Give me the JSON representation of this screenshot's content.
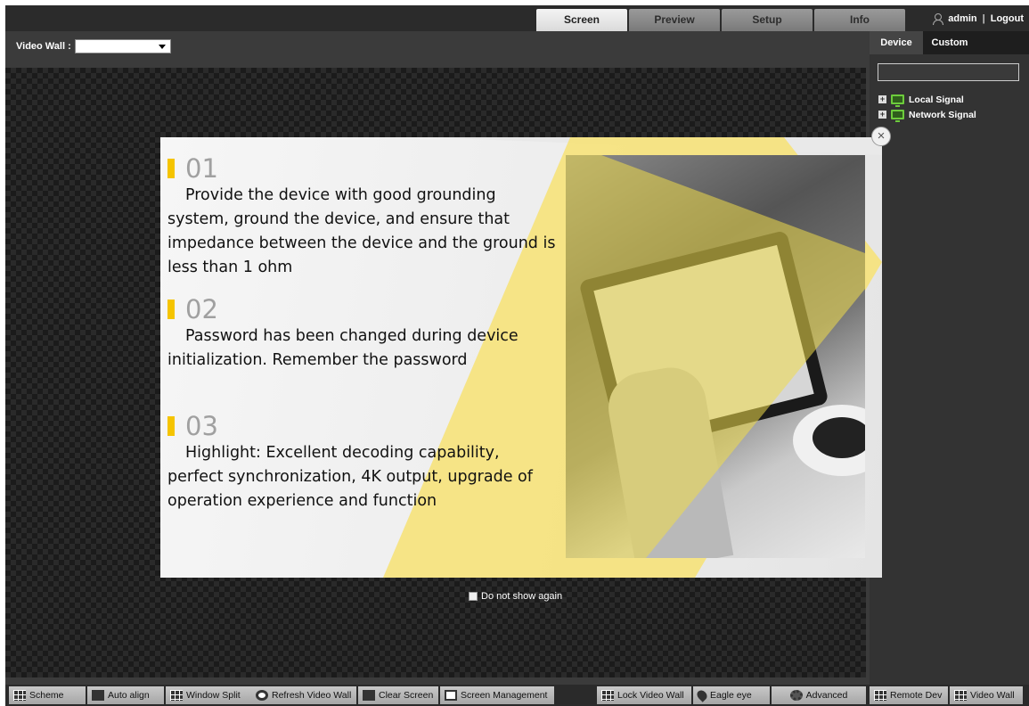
{
  "header": {
    "tabs": [
      {
        "label": "Screen",
        "active": true
      },
      {
        "label": "Preview",
        "active": false
      },
      {
        "label": "Setup",
        "active": false
      },
      {
        "label": "Info",
        "active": false
      }
    ],
    "user": "admin",
    "separator": "|",
    "logout": "Logout"
  },
  "workspace": {
    "video_wall_label": "Video Wall :",
    "video_wall_value": ""
  },
  "right_panel": {
    "tabs": [
      {
        "label": "Device",
        "active": true
      },
      {
        "label": "Custom",
        "active": false
      }
    ],
    "search_value": "",
    "tree": [
      {
        "label": "Local Signal",
        "icon": "local-signal-icon"
      },
      {
        "label": "Network Signal",
        "icon": "network-signal-icon"
      }
    ]
  },
  "popup": {
    "points": [
      {
        "number": "01",
        "text": "Provide the device with good grounding system, ground the device, and ensure that impedance between the device and the ground is less than 1 ohm"
      },
      {
        "number": "02",
        "text": "Password has been changed during device initialization. Remember the password"
      },
      {
        "number": "03",
        "text": "Highlight: Excellent decoding capability, perfect synchronization, 4K output, upgrade of operation experience and function"
      }
    ],
    "close_symbol": "×",
    "dont_show_label": "Do not show again",
    "accent_color": "#f5c400"
  },
  "toolbar": {
    "left": [
      {
        "label": "Scheme",
        "icon": "scheme-icon"
      },
      {
        "label": "Auto align",
        "icon": "auto-align-icon"
      },
      {
        "label": "Window Split",
        "icon": "window-split-icon"
      },
      {
        "label": "Refresh Video Wall",
        "icon": "refresh-icon"
      },
      {
        "label": "Clear Screen",
        "icon": "clear-screen-icon"
      },
      {
        "label": "Screen Management",
        "icon": "monitor-icon"
      }
    ],
    "middle": [
      {
        "label": "Lock Video Wall",
        "icon": "lock-video-wall-icon"
      },
      {
        "label": "Eagle eye",
        "icon": "location-pin-icon"
      },
      {
        "label": "Advanced",
        "icon": "gear-icon"
      }
    ],
    "right": [
      {
        "label": "Remote Dev",
        "icon": "remote-dev-icon"
      },
      {
        "label": "Video Wall",
        "icon": "video-wall-icon"
      }
    ]
  }
}
